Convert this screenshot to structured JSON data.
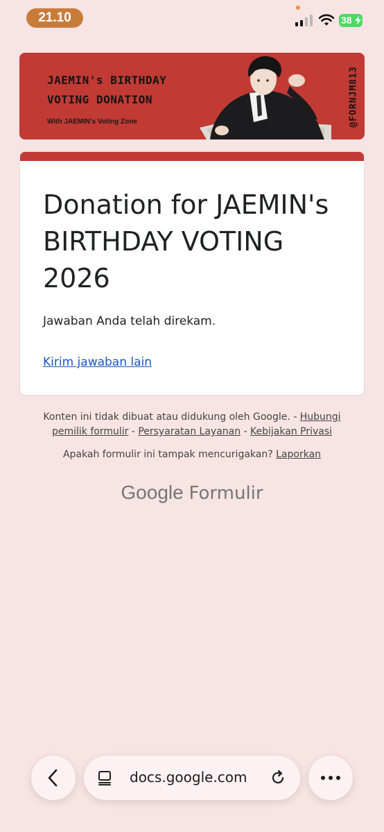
{
  "status_bar": {
    "time": "21.10",
    "battery": "38",
    "battery_color": "#4cd964",
    "time_pill_color": "#c97c3a"
  },
  "banner": {
    "title_line1": "JAEMIN's BIRTHDAY",
    "title_line2": "VOTING DONATION",
    "subtitle": "With JAEMIN's Voting Zone",
    "handle": "@FORNJM813",
    "background_color": "#c13a34"
  },
  "form": {
    "title": "Donation for JAEMIN's BIRTHDAY VOTING 2026",
    "confirmation": "Jawaban Anda telah direkam.",
    "another_response_link": "Kirim jawaban lain",
    "accent_color": "#c13a34"
  },
  "footer": {
    "disclaimer": "Konten ini tidak dibuat atau didukung oleh Google.",
    "sep": " - ",
    "contact_owner": "Hubungi pemilik formulir",
    "terms": "Persyaratan Layanan",
    "privacy": "Kebijakan Privasi",
    "suspicious_question": "Apakah formulir ini tampak mencurigakan?",
    "report": "Laporkan",
    "brand_google": "Google",
    "brand_forms": "Formulir"
  },
  "browser": {
    "url": "docs.google.com",
    "back_icon": "chevron-left-icon",
    "tabs_icon": "tabs-icon",
    "reload_icon": "reload-icon",
    "more_icon": "more-icon"
  }
}
